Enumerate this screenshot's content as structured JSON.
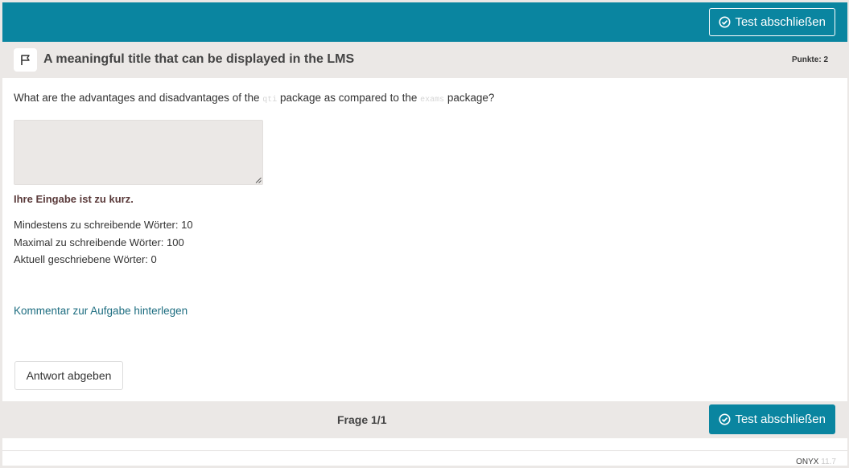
{
  "topbar": {
    "finish_button": "Test abschließen",
    "accent": "#0a85a0"
  },
  "question": {
    "flag_icon": "flag-icon",
    "title": "A meaningful title that can be displayed in the LMS",
    "points_label": "Punkte:",
    "points_value": "2",
    "text_before": "What are the advantages and disadvantages of the ",
    "code1": "qti",
    "text_middle": " package as compared to the ",
    "code2": "exams",
    "text_after": " package?",
    "answer_value": "",
    "warning": "Ihre Eingabe ist zu kurz.",
    "stats": {
      "min_words": "Mindestens zu schreibende Wörter: 10",
      "max_words": "Maximal zu schreibende Wörter: 100",
      "current_words": "Aktuell geschriebene Wörter: 0"
    },
    "comment_link": "Kommentar zur Aufgabe hinterlegen",
    "submit_button": "Antwort abgeben"
  },
  "footer": {
    "question_counter": "Frage 1/1",
    "finish_button": "Test abschließen"
  },
  "version": {
    "product": "ONYX",
    "number": "11.7"
  }
}
